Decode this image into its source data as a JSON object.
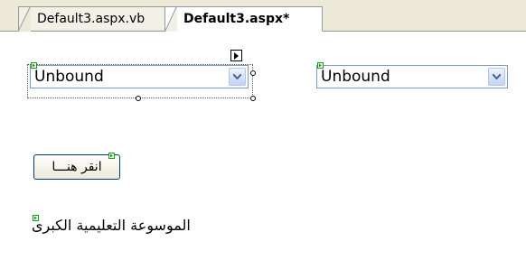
{
  "tabs": [
    {
      "label": "Default3.aspx.vb",
      "active": false
    },
    {
      "label": "Default3.aspx*",
      "active": true
    }
  ],
  "designer": {
    "dropdown1": {
      "value": "Unbound"
    },
    "dropdown2": {
      "value": "Unbound"
    },
    "button": {
      "label": "انقر هنـــا"
    },
    "label": {
      "text": "الموسوعة التعليمية الكبرى"
    }
  },
  "colors": {
    "tab_strip": "#ece9d8",
    "control_border": "#7f9db9",
    "button_border": "#003c74",
    "control_glyph": "#1a9b1a"
  },
  "icons": {
    "dropdown_arrow": "chevron-down-icon",
    "smart_tag": "smart-tag-arrow-icon",
    "control_glyph": "server-control-glyph-icon"
  }
}
